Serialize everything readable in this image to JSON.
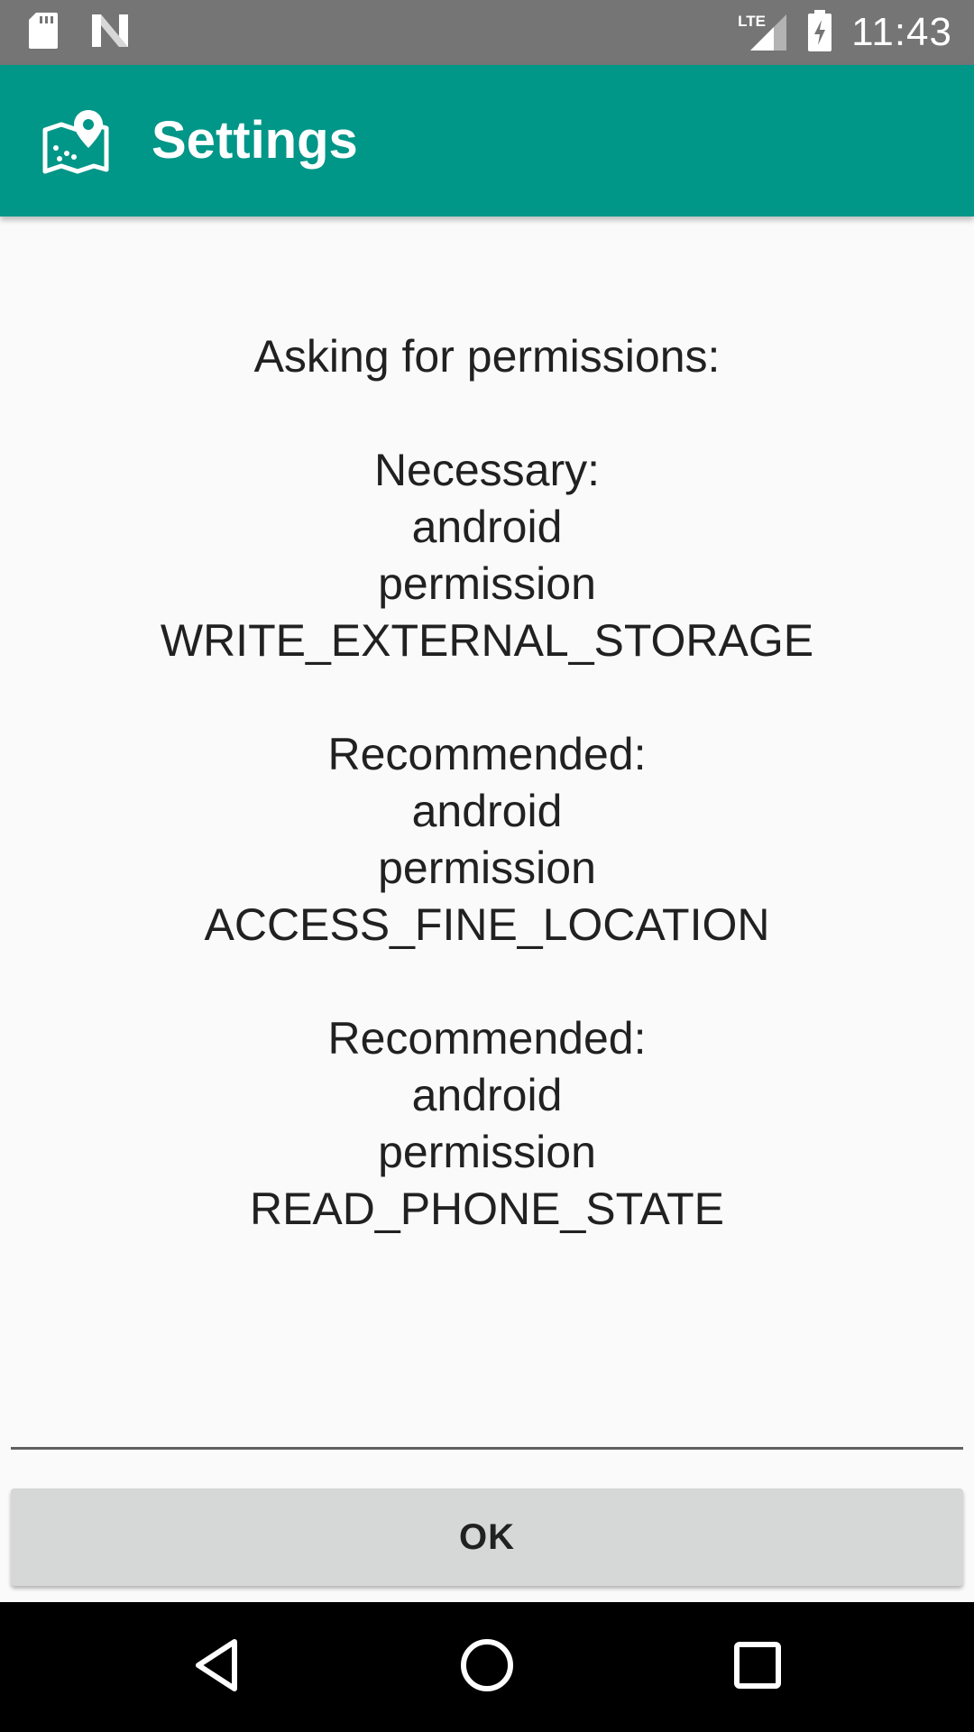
{
  "status_bar": {
    "time": "11:43",
    "network_label": "LTE",
    "icons": [
      "sd-card-icon",
      "n-logo-icon",
      "lte-signal-icon",
      "battery-charging-icon"
    ]
  },
  "app_bar": {
    "title": "Settings",
    "icon": "map-location-icon",
    "color": "#009688"
  },
  "permissions": {
    "heading": "Asking for permissions:",
    "items": [
      {
        "category": "Necessary:",
        "line1": "android",
        "line2": "permission",
        "name": "WRITE_EXTERNAL_STORAGE"
      },
      {
        "category": "Recommended:",
        "line1": "android",
        "line2": "permission",
        "name": "ACCESS_FINE_LOCATION"
      },
      {
        "category": "Recommended:",
        "line1": "android",
        "line2": "permission",
        "name": "READ_PHONE_STATE"
      }
    ]
  },
  "actions": {
    "ok_label": "OK"
  },
  "nav_bar": {
    "icons": [
      "back-icon",
      "home-icon",
      "recents-icon"
    ]
  }
}
